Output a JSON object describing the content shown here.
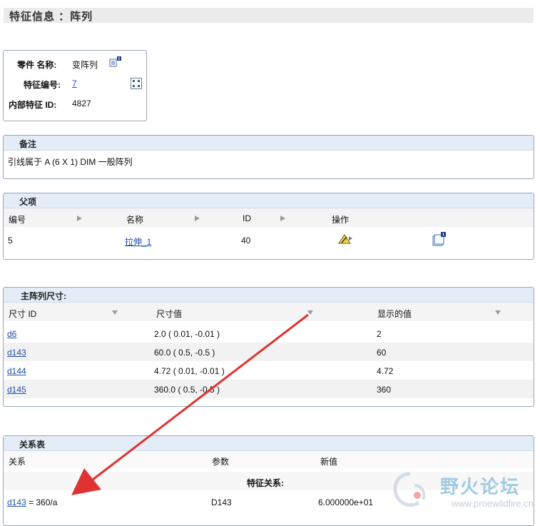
{
  "header": {
    "title": "特征信息 ：阵列"
  },
  "part_box": {
    "part_label": "零件  名称:",
    "part_value": "变阵列",
    "feature_no_label": "特征编号:",
    "feature_no_value": "7",
    "internal_id_label": "内部特征  ID:",
    "internal_id_value": "4827"
  },
  "notes": {
    "title": "备注",
    "text": "引线属于  A (6 X 1) DIM 一般阵列"
  },
  "parents": {
    "title": "父项",
    "columns": [
      "编号",
      "名称",
      "ID",
      "操作"
    ],
    "row": {
      "number": "5",
      "name": "拉伸_1",
      "id": "40"
    }
  },
  "dimensions": {
    "title": "主阵列尺寸:",
    "columns": [
      "尺寸  ID",
      "尺寸值",
      "显示的值"
    ],
    "rows": [
      {
        "id": "d6",
        "value": "2.0 ( 0.01, -0.01 )",
        "display": "2"
      },
      {
        "id": "d143",
        "value": "60.0 ( 0.5, -0.5 )",
        "display": "60"
      },
      {
        "id": "d144",
        "value": "4.72 ( 0.01, -0.01 )",
        "display": "4.72"
      },
      {
        "id": "d145",
        "value": "360.0 ( 0.5, -0.5 )",
        "display": "360"
      }
    ]
  },
  "relations": {
    "title": "关系表",
    "columns": [
      "关系",
      "参数",
      "新值"
    ],
    "subheading": "特征关系:",
    "row": {
      "link": "d143",
      "expr": " = 360/a",
      "param": "D143",
      "new_value": "6.000000e+01"
    }
  },
  "watermark": {
    "text_cn": "野火论坛",
    "text_url": "www.proewildfire.cn"
  },
  "colors": {
    "accent": "#e03232",
    "title_bar": "#e3ecf7",
    "link": "#1d4fa8"
  }
}
